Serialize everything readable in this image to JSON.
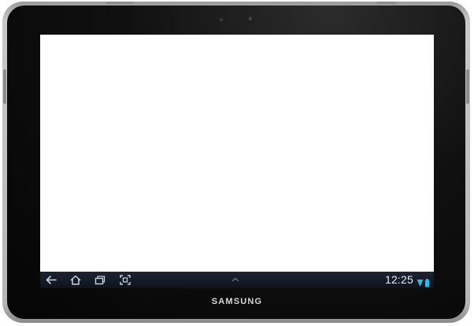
{
  "device": {
    "brand": "SAMSUNG"
  },
  "system_bar": {
    "clock": "12:25",
    "nav_icons": [
      "back-icon",
      "home-icon",
      "recent-apps-icon",
      "screenshot-icon",
      "chevron-up-icon"
    ],
    "status_icons": [
      "wifi-icon",
      "battery-icon"
    ],
    "accent_color": "#33b5e5",
    "background_color": "#121a24"
  },
  "screen": {
    "background_color": "#ffffff"
  }
}
